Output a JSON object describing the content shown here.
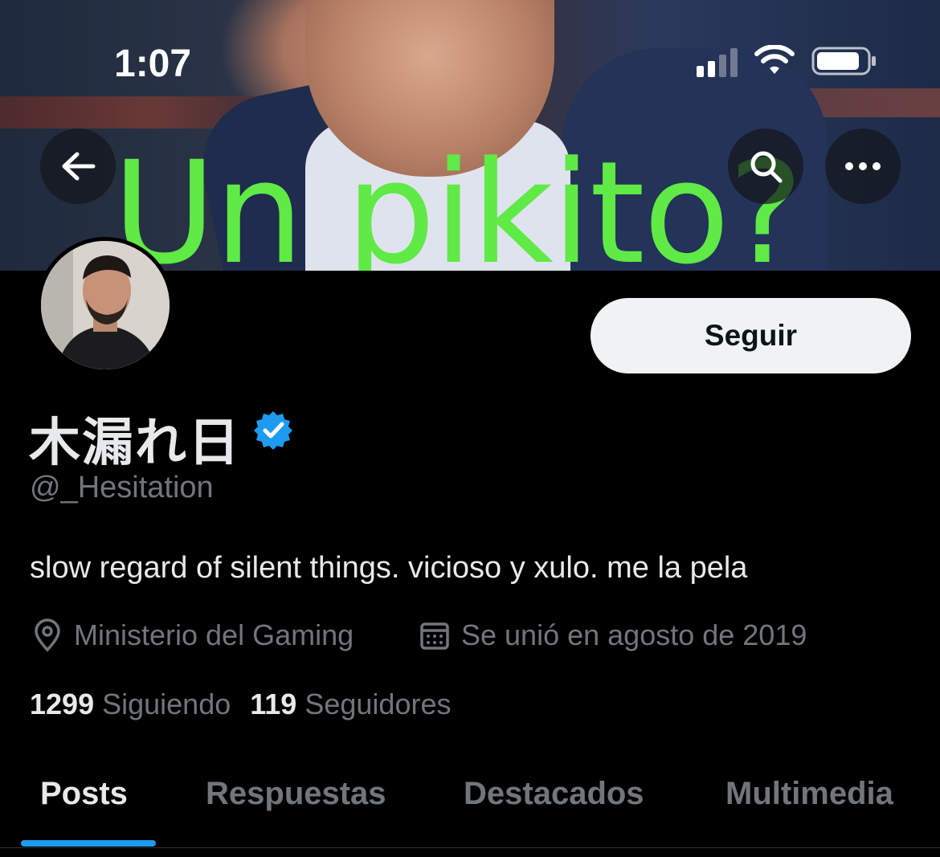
{
  "status_bar": {
    "time": "1:07",
    "signal_bars_active": 2,
    "signal_bars_total": 4
  },
  "banner": {
    "caption": "Un pikito?",
    "caption_color": "#5fea45"
  },
  "header": {
    "back_icon": "arrow-left-icon",
    "search_icon": "search-icon",
    "more_icon": "more-horizontal-icon"
  },
  "profile": {
    "display_name": "木漏れ日",
    "verified": true,
    "verified_color": "#1d9bf0",
    "handle": "@_Hesitation",
    "bio": "slow regard of silent things. vicioso y xulo. me la pela",
    "location": "Ministerio del Gaming",
    "location_icon": "location-pin-icon",
    "joined": "Se unió en agosto de 2019",
    "joined_icon": "calendar-icon",
    "following_count": "1299",
    "following_label": "Siguiendo",
    "followers_count": "119",
    "followers_label": "Seguidores"
  },
  "actions": {
    "follow_label": "Seguir"
  },
  "tabs": [
    {
      "label": "Posts",
      "active": true
    },
    {
      "label": "Respuestas",
      "active": false
    },
    {
      "label": "Destacados",
      "active": false
    },
    {
      "label": "Multimedia",
      "active": false
    }
  ],
  "colors": {
    "accent": "#1d9bf0",
    "background": "#000000",
    "secondary_text": "#71767b"
  }
}
